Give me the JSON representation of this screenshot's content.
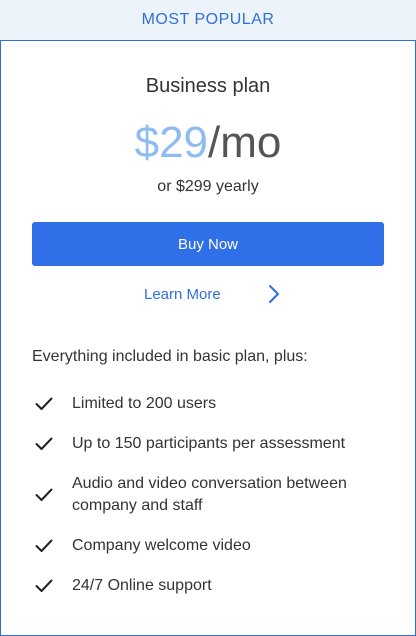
{
  "ribbon": {
    "label": "MOST POPULAR"
  },
  "plan": {
    "name": "Business plan",
    "price_amount": "$29",
    "price_period": "/mo",
    "yearly": "or $299 yearly"
  },
  "actions": {
    "buy_label": "Buy Now",
    "learn_more_label": "Learn More"
  },
  "features": {
    "intro": "Everything included in basic plan, plus:",
    "items": [
      {
        "label": "Limited to 200 users"
      },
      {
        "label": "Up to 150 participants per assessment"
      },
      {
        "label": "Audio and video conversation between company and staff"
      },
      {
        "label": "Company welcome video"
      },
      {
        "label": "24/7 Online support"
      }
    ]
  },
  "colors": {
    "accent": "#2f6fdb",
    "button": "#2f6fe8",
    "ribbon_bg": "#edf3fb",
    "price_amount": "#8fbcf0"
  },
  "icons": {
    "feature_check": "check-icon",
    "learn_more": "chevron-right-icon"
  }
}
